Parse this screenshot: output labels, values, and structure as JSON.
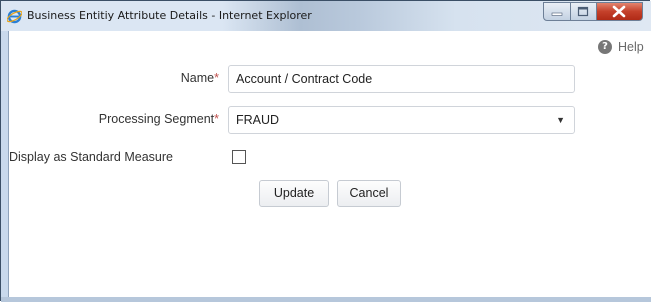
{
  "window": {
    "title": "Business Entitiy Attribute Details - Internet Explorer",
    "icon": "ie-icon",
    "controls": [
      "minimize-icon",
      "maximize-icon",
      "close-icon"
    ]
  },
  "help": {
    "label": "Help",
    "icon": "help-icon"
  },
  "form": {
    "name_label": "Name",
    "name_value": "Account / Contract Code",
    "segment_label": "Processing Segment",
    "segment_value": "FRAUD",
    "standard_measure_label": "Display as Standard Measure",
    "standard_measure_checked": false,
    "required_marker": "*"
  },
  "buttons": {
    "update": "Update",
    "cancel": "Cancel"
  },
  "colors": {
    "required": "#c0504d",
    "close_button": "#c4402a"
  }
}
